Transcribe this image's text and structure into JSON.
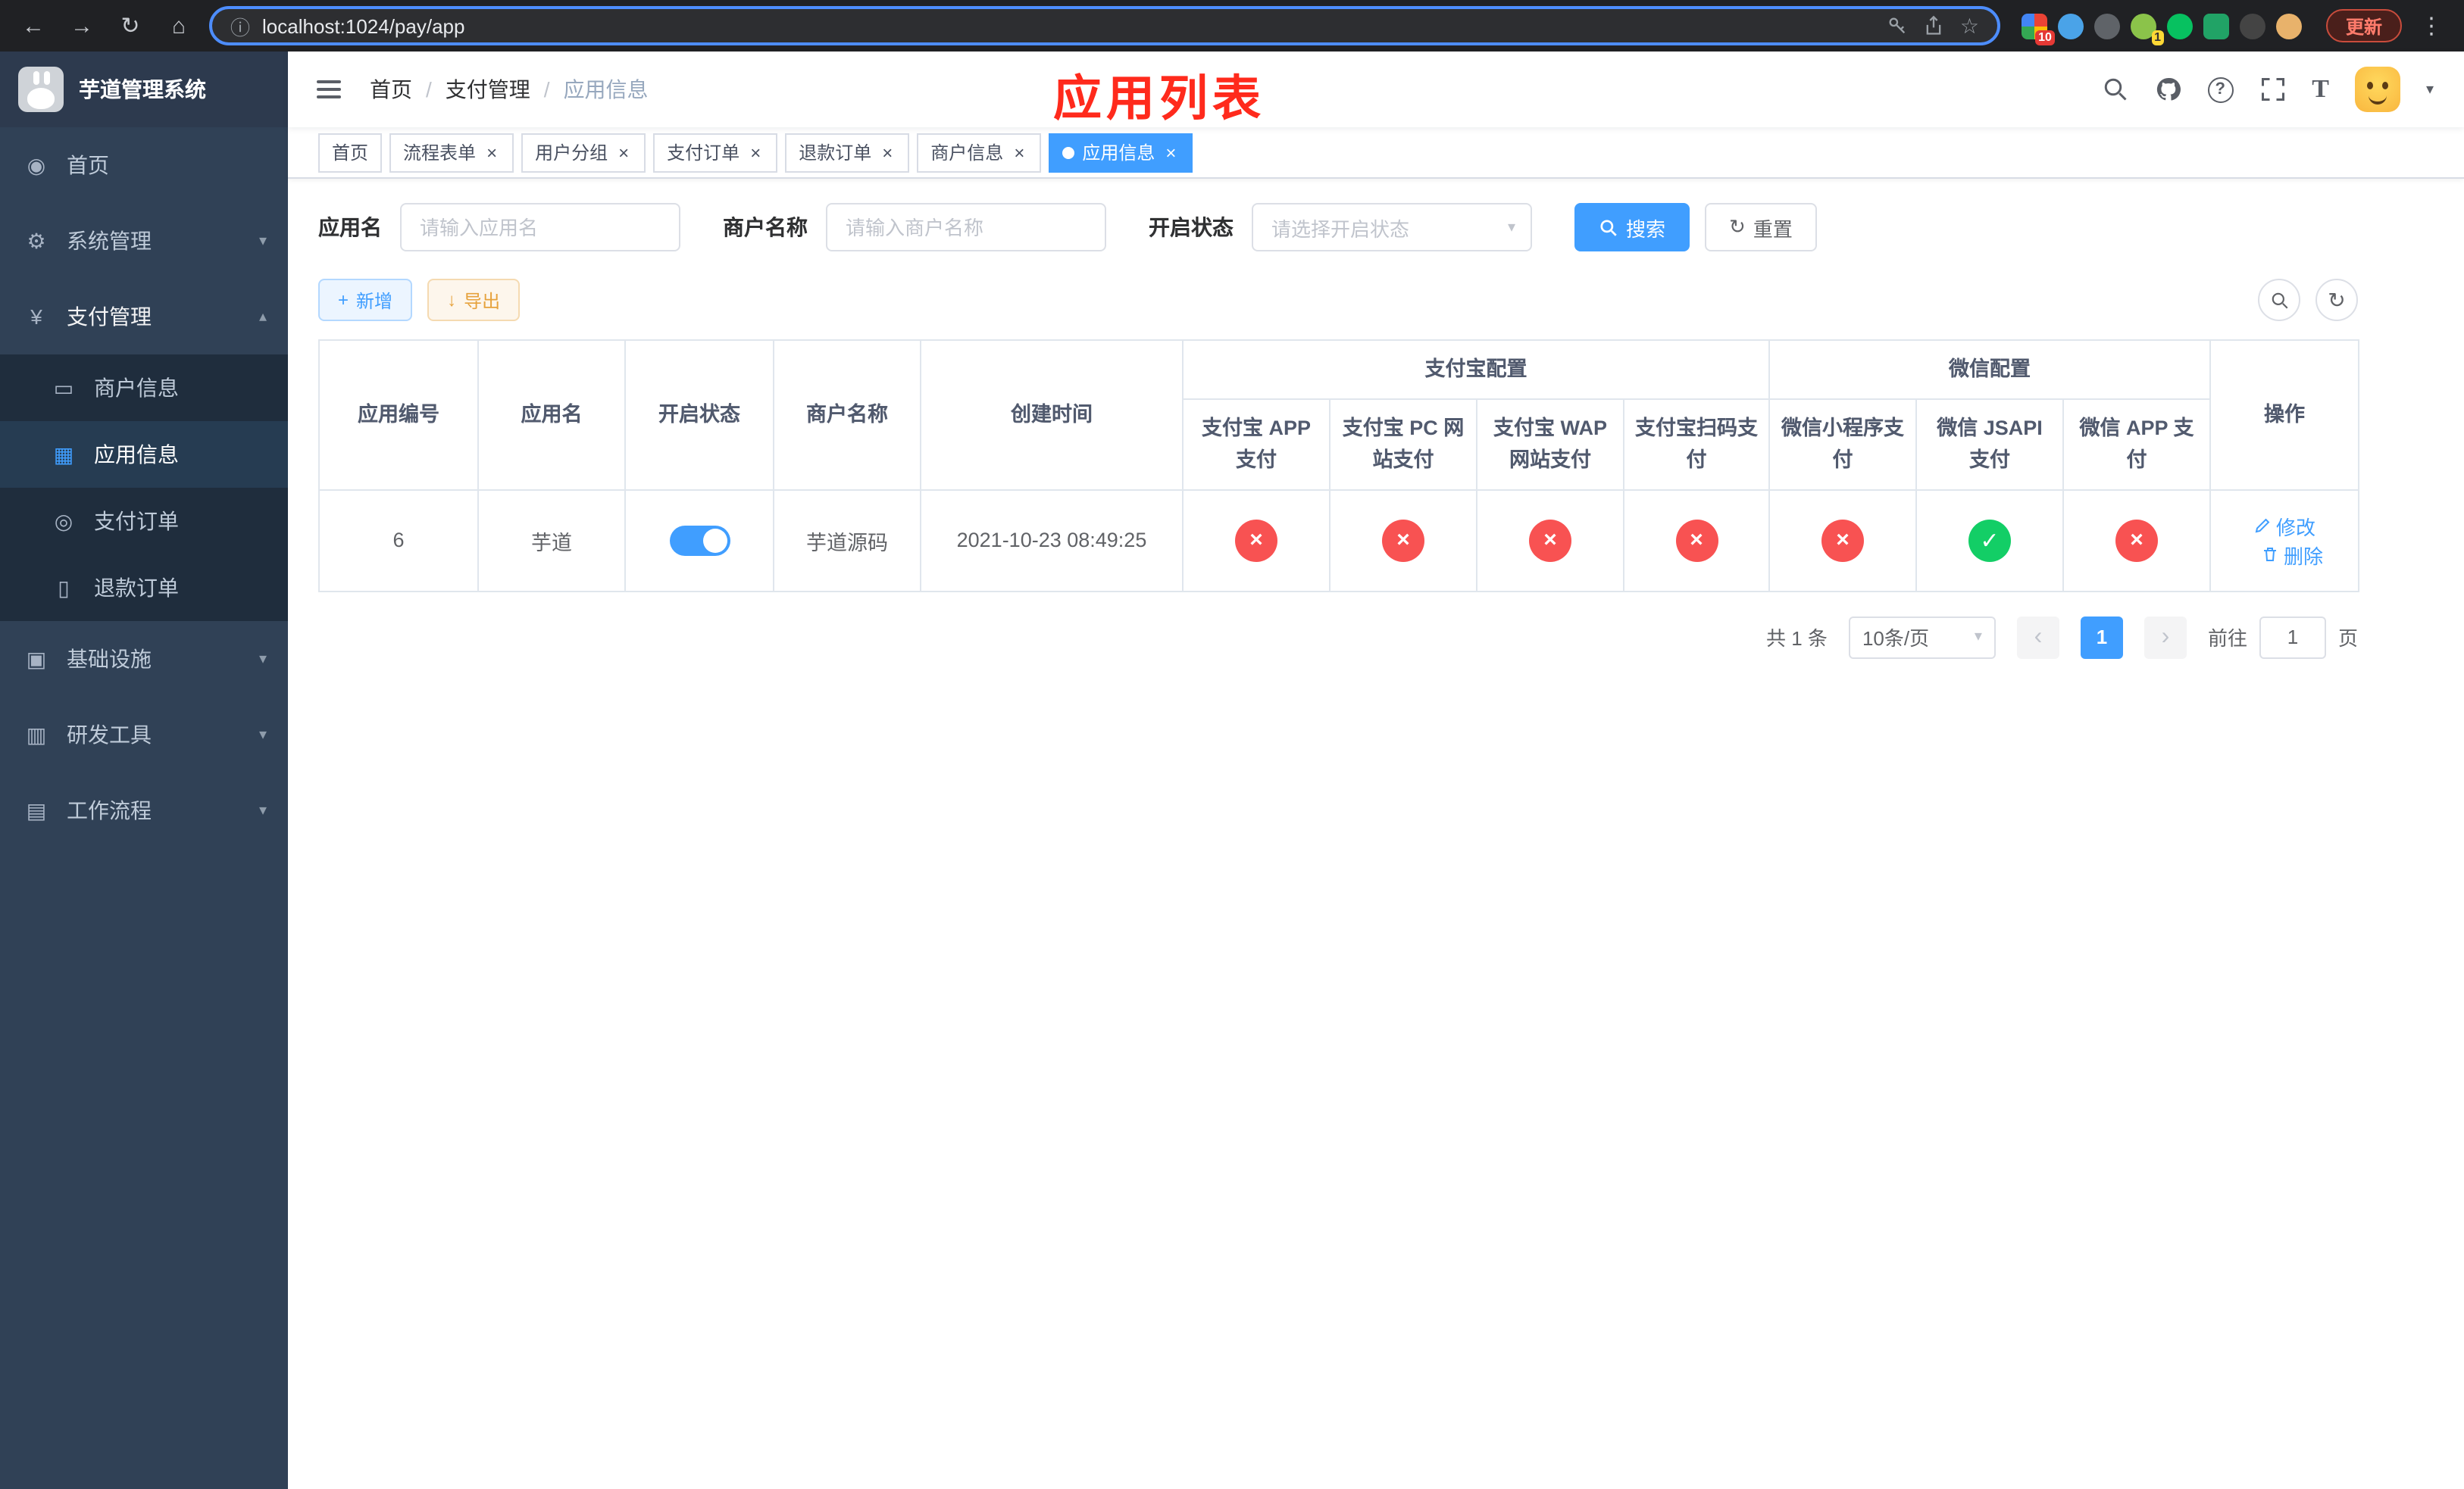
{
  "colors": {
    "accent": "#409eff",
    "success": "#13ce66",
    "danger": "#f85252",
    "warning": "#e6a23c",
    "annotation_red": "#ff2a1c",
    "sidebar_bg": "#304156",
    "sidebar_submenu_bg": "#1f2d3d"
  },
  "icons": {
    "back": "←",
    "forward": "→",
    "reload": "↻",
    "home": "⌂",
    "info": "ⓘ",
    "star": "☆",
    "menu_dots": "⋮",
    "chevron_down": "▾",
    "chevron_up": "▴",
    "dashboard": "◉",
    "gear": "⚙",
    "yen": "¥",
    "merchant_card": "▭",
    "app_grid": "▦",
    "order_circle": "◎",
    "refund_doc": "▯",
    "infra_monitor": "▣",
    "tools_box": "▥",
    "workflow_box": "▤",
    "plus": "+",
    "download": "↓",
    "refresh": "↻",
    "close": "×",
    "ok": "✓",
    "fail": "×",
    "question": "?",
    "font_size": "T",
    "prev": "‹",
    "next": "›"
  },
  "browser": {
    "url": "localhost:1024/pay/app",
    "update_label": "更新",
    "ext_badges": {
      "first": "10",
      "green": "1"
    }
  },
  "sidebar": {
    "logo_title": "芋道管理系统",
    "items": [
      {
        "label": "首页"
      },
      {
        "label": "系统管理"
      },
      {
        "label": "支付管理"
      },
      {
        "label": "基础设施"
      },
      {
        "label": "研发工具"
      },
      {
        "label": "工作流程"
      }
    ],
    "pay_submenu": [
      {
        "label": "商户信息"
      },
      {
        "label": "应用信息"
      },
      {
        "label": "支付订单"
      },
      {
        "label": "退款订单"
      }
    ]
  },
  "header": {
    "breadcrumb": [
      "首页",
      "支付管理",
      "应用信息"
    ],
    "breadcrumb_separator": "/",
    "annotation": "应用列表"
  },
  "tabs": [
    {
      "label": "首页"
    },
    {
      "label": "流程表单"
    },
    {
      "label": "用户分组"
    },
    {
      "label": "支付订单"
    },
    {
      "label": "退款订单"
    },
    {
      "label": "商户信息"
    },
    {
      "label": "应用信息"
    }
  ],
  "filters": {
    "app_name_label": "应用名",
    "app_name_placeholder": "请输入应用名",
    "merchant_label": "商户名称",
    "merchant_placeholder": "请输入商户名称",
    "status_label": "开启状态",
    "status_placeholder": "请选择开启状态",
    "search_label": "搜索",
    "reset_label": "重置"
  },
  "toolbar": {
    "add_label": "新增",
    "export_label": "导出"
  },
  "table": {
    "headers": {
      "app_id": "应用编号",
      "app_name": "应用名",
      "status": "开启状态",
      "merchant": "商户名称",
      "created_at": "创建时间",
      "alipay_group": "支付宝配置",
      "wechat_group": "微信配置",
      "alipay_app": "支付宝 APP 支付",
      "alipay_pc": "支付宝 PC 网站支付",
      "alipay_wap": "支付宝 WAP 网站支付",
      "alipay_qr": "支付宝扫码支付",
      "wechat_mini": "微信小程序支付",
      "wechat_jsapi": "微信 JSAPI 支付",
      "wechat_app": "微信 APP 支付",
      "actions": "操作"
    },
    "rows": [
      {
        "app_id": "6",
        "app_name": "芋道",
        "enabled": true,
        "merchant": "芋道源码",
        "created_at": "2021-10-23 08:49:25",
        "configs": {
          "alipay_app": false,
          "alipay_pc": false,
          "alipay_wap": false,
          "alipay_qr": false,
          "wechat_mini": false,
          "wechat_jsapi": true,
          "wechat_app": false
        },
        "edit_label": "修改",
        "delete_label": "删除"
      }
    ]
  },
  "pagination": {
    "total": "共 1 条",
    "page_size": "10条/页",
    "page": "1",
    "goto_label": "前往",
    "goto_value": "1",
    "goto_suffix": "页"
  }
}
